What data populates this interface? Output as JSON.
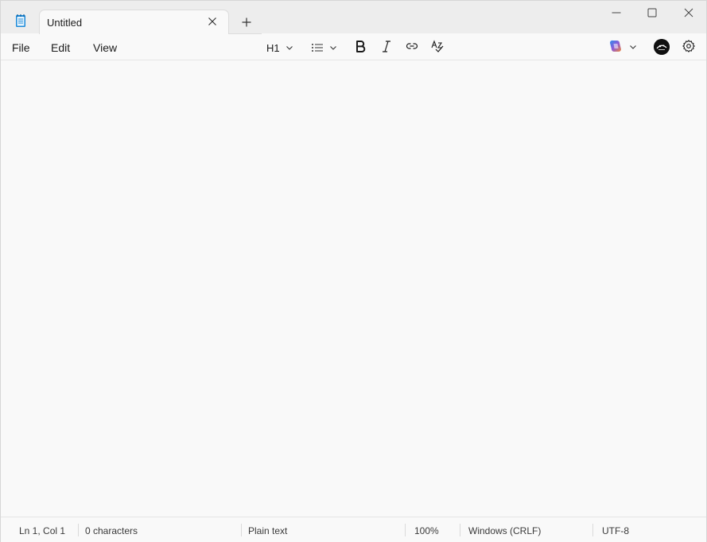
{
  "tab": {
    "title": "Untitled"
  },
  "menu": {
    "file": "File",
    "edit": "Edit",
    "view": "View"
  },
  "toolbar": {
    "heading_label": "H1"
  },
  "editor": {
    "content": ""
  },
  "status": {
    "position": "Ln 1, Col 1",
    "characters": "0 characters",
    "format": "Plain text",
    "zoom": "100%",
    "line_ending": "Windows (CRLF)",
    "encoding": "UTF-8"
  },
  "colors": {
    "accent": "#1e8bd9",
    "titlebar": "#ededed",
    "background": "#f9f9f9"
  },
  "icons": [
    "notepad-app-icon",
    "close-icon",
    "plus-icon",
    "minimize-icon",
    "maximize-icon",
    "chevron-down-icon",
    "list-icon",
    "bold-icon",
    "italic-icon",
    "link-icon",
    "spellcheck-icon",
    "copilot-icon",
    "avatar",
    "gear-icon"
  ]
}
